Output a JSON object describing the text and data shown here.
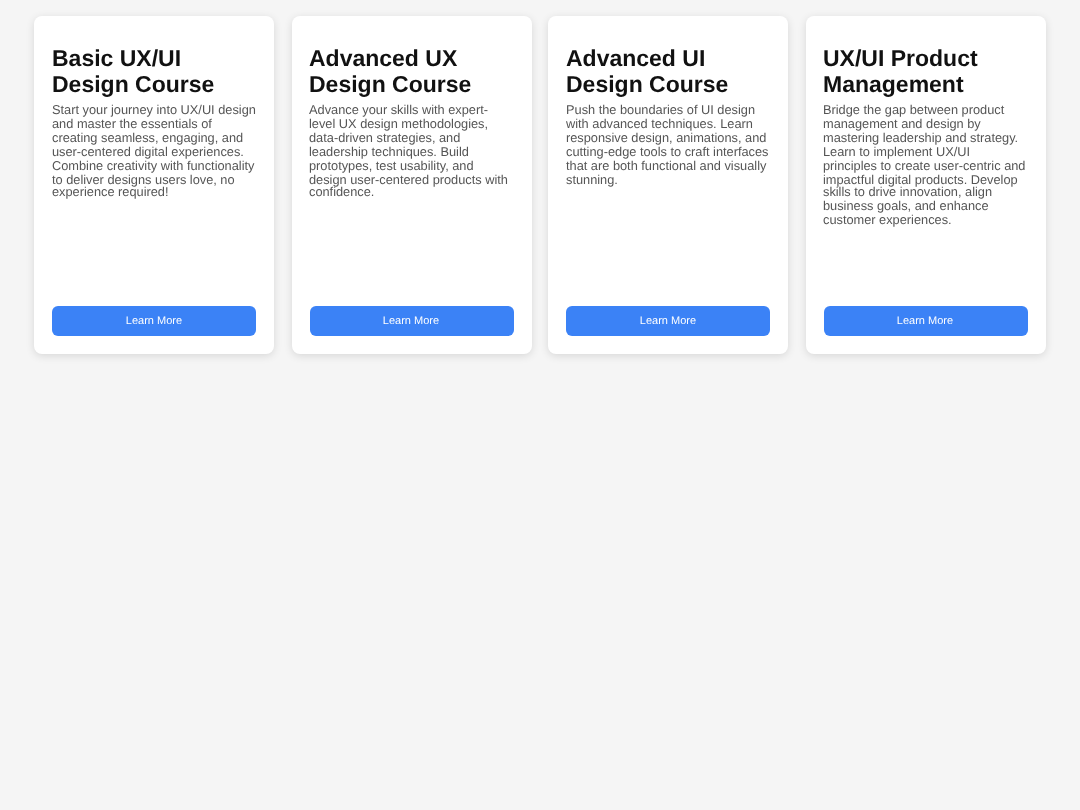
{
  "courses": [
    {
      "title": "Basic UX/UI Design Course",
      "description": "Start your journey into UX/UI design and master the essentials of creating seamless, engaging, and user-centered digital experiences. Combine creativity with functionality to deliver designs users love, no experience required!",
      "button": "Learn More"
    },
    {
      "title": "Advanced UX Design Course",
      "description": "Advance your skills with expert-level UX design methodologies, data-driven strategies, and leadership techniques. Build prototypes, test usability, and design user-centered products with confidence.",
      "button": "Learn More"
    },
    {
      "title": "Advanced UI Design Course",
      "description": "Push the boundaries of UI design with advanced techniques. Learn responsive design, animations, and cutting-edge tools to craft interfaces that are both functional and visually stunning.",
      "button": "Learn More"
    },
    {
      "title": "UX/UI Product Management",
      "description": "Bridge the gap between product management and design by mastering leadership and strategy. Learn to implement UX/UI principles to create user-centric and impactful digital products. Develop skills to drive innovation, align business goals, and enhance customer experiences.",
      "button": "Learn More"
    }
  ]
}
